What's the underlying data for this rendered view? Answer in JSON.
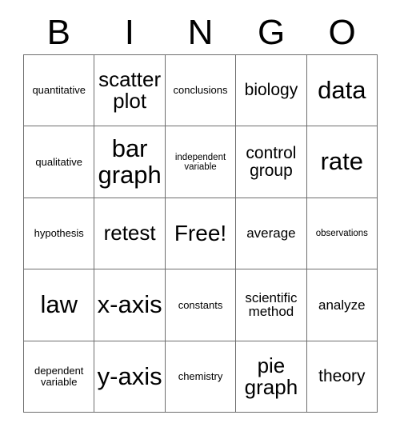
{
  "header": {
    "letters": [
      "B",
      "I",
      "N",
      "G",
      "O"
    ]
  },
  "grid": {
    "free_space_label": "Free!",
    "rows": [
      [
        {
          "text": "quantitative",
          "size": "fs-sm"
        },
        {
          "text": "scatter plot",
          "size": "fs-xl"
        },
        {
          "text": "conclusions",
          "size": "fs-sm"
        },
        {
          "text": "biology",
          "size": "fs-lg"
        },
        {
          "text": "data",
          "size": "fs-xxl"
        }
      ],
      [
        {
          "text": "qualitative",
          "size": "fs-sm"
        },
        {
          "text": "bar graph",
          "size": "fs-xxl"
        },
        {
          "text": "independent variable",
          "size": "fs-xs"
        },
        {
          "text": "control group",
          "size": "fs-lg"
        },
        {
          "text": "rate",
          "size": "fs-xxl"
        }
      ],
      [
        {
          "text": "hypothesis",
          "size": "fs-sm"
        },
        {
          "text": "retest",
          "size": "fs-xl"
        },
        {
          "text": "Free!",
          "size": "fs-free"
        },
        {
          "text": "average",
          "size": "fs-md"
        },
        {
          "text": "observations",
          "size": "fs-xs"
        }
      ],
      [
        {
          "text": "law",
          "size": "fs-xxl"
        },
        {
          "text": "x-axis",
          "size": "fs-xxl"
        },
        {
          "text": "constants",
          "size": "fs-sm"
        },
        {
          "text": "scientific method",
          "size": "fs-md"
        },
        {
          "text": "analyze",
          "size": "fs-md"
        }
      ],
      [
        {
          "text": "dependent variable",
          "size": "fs-sm"
        },
        {
          "text": "y-axis",
          "size": "fs-xxl"
        },
        {
          "text": "chemistry",
          "size": "fs-sm"
        },
        {
          "text": "pie graph",
          "size": "fs-xl"
        },
        {
          "text": "theory",
          "size": "fs-lg"
        }
      ]
    ]
  },
  "colors": {
    "background": "#ffffff",
    "grid_line": "#6e6e6e",
    "text": "#000000"
  }
}
